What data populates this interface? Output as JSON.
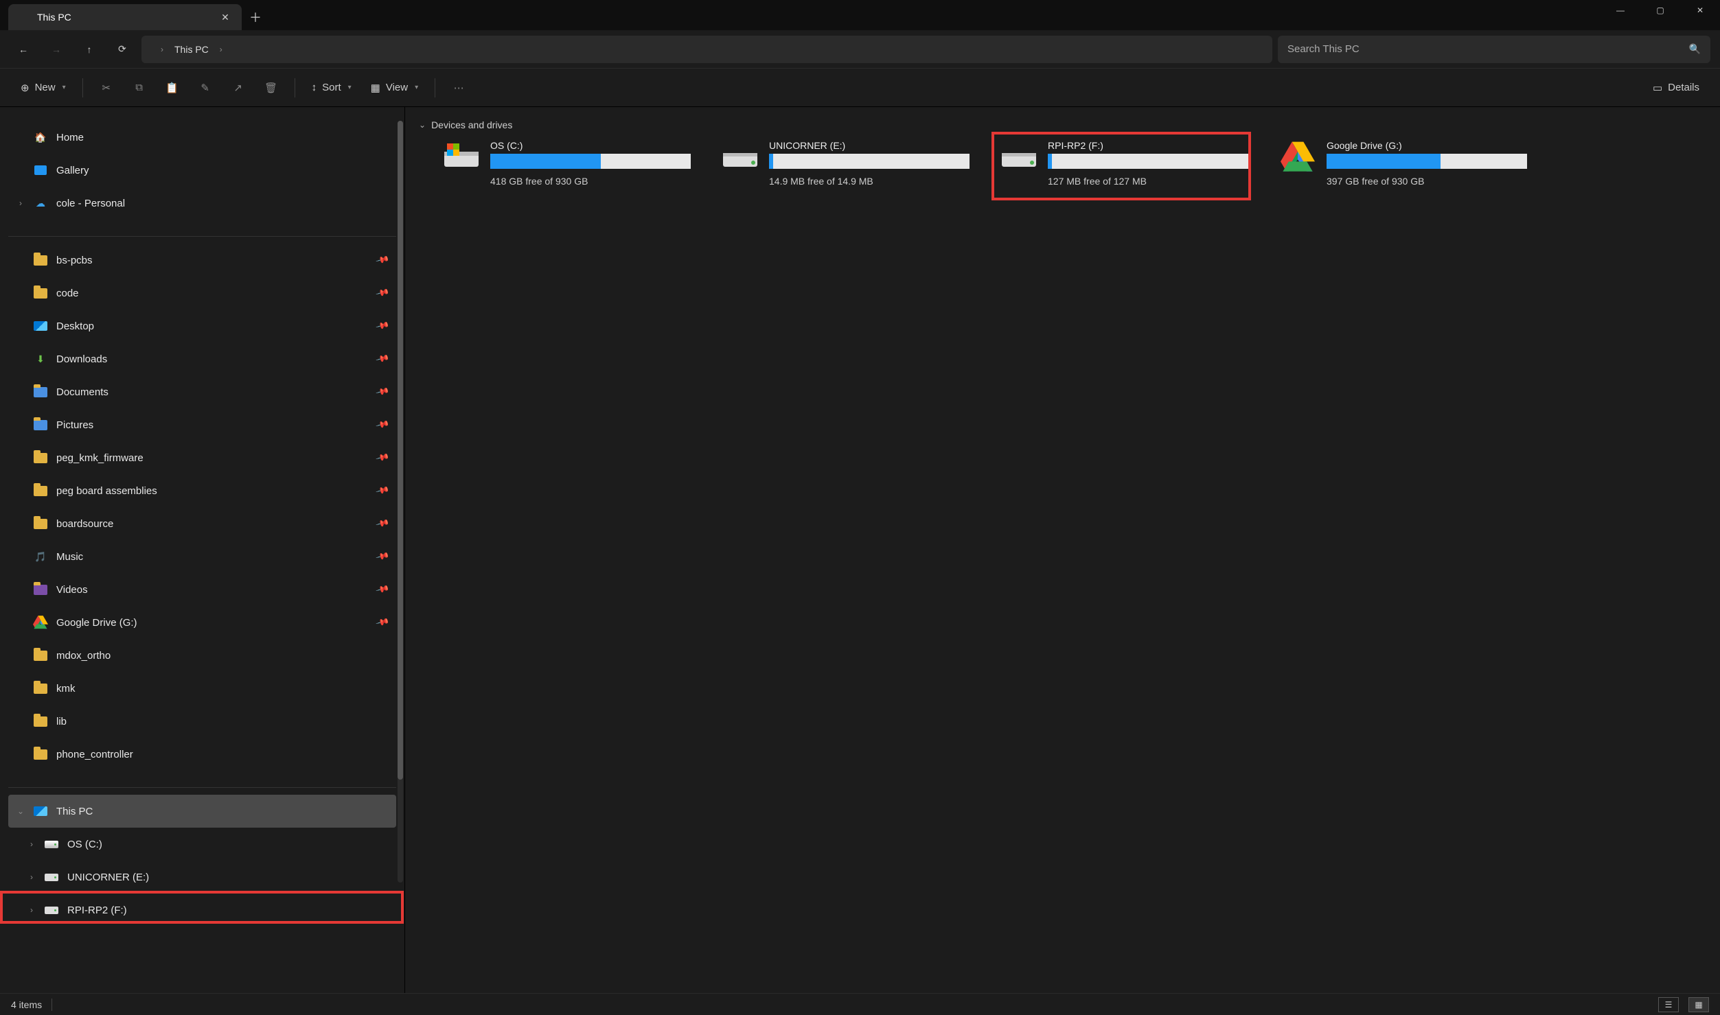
{
  "window": {
    "tab_title": "This PC",
    "min_icon": "—",
    "max_icon": "▢",
    "close_icon": "✕",
    "newtab_icon": "＋",
    "tab_close_icon": "✕"
  },
  "nav": {
    "back_icon": "←",
    "forward_icon": "→",
    "up_icon": "↑",
    "refresh_icon": "⟳",
    "pc_icon": "🖥",
    "crumb_sep": "›",
    "crumb_current": "This PC",
    "search_placeholder": "Search This PC",
    "search_icon": "🔍"
  },
  "toolbar": {
    "new_label": "New",
    "new_icon": "⊕",
    "cut_icon": "✂",
    "copy_icon": "⧉",
    "paste_icon": "📋",
    "rename_icon": "✎",
    "share_icon": "↗",
    "delete_icon": "🗑",
    "sort_label": "Sort",
    "sort_icon": "↕",
    "view_label": "View",
    "view_icon": "▦",
    "more_icon": "⋯",
    "details_label": "Details",
    "details_icon": "▭"
  },
  "sidebar": {
    "top": [
      {
        "label": "Home",
        "icon": "home"
      },
      {
        "label": "Gallery",
        "icon": "gallery"
      },
      {
        "label": "cole - Personal",
        "icon": "cloud",
        "expandable": true
      }
    ],
    "pinned": [
      {
        "label": "bs-pcbs",
        "icon": "folder"
      },
      {
        "label": "code",
        "icon": "folder"
      },
      {
        "label": "Desktop",
        "icon": "desktop"
      },
      {
        "label": "Downloads",
        "icon": "downloads"
      },
      {
        "label": "Documents",
        "icon": "documents"
      },
      {
        "label": "Pictures",
        "icon": "pictures"
      },
      {
        "label": "peg_kmk_firmware",
        "icon": "folder"
      },
      {
        "label": "peg board assemblies",
        "icon": "folder"
      },
      {
        "label": "boardsource",
        "icon": "folder"
      },
      {
        "label": "Music",
        "icon": "music"
      },
      {
        "label": "Videos",
        "icon": "videos"
      },
      {
        "label": "Google Drive (G:)",
        "icon": "gdrive"
      }
    ],
    "unpinned": [
      {
        "label": "mdox_ortho",
        "icon": "folder"
      },
      {
        "label": "kmk",
        "icon": "folder"
      },
      {
        "label": "lib",
        "icon": "folder"
      },
      {
        "label": "phone_controller",
        "icon": "folder"
      }
    ],
    "thispc": {
      "label": "This PC",
      "children": [
        {
          "label": "OS (C:)",
          "icon": "osdrive"
        },
        {
          "label": "UNICORNER (E:)",
          "icon": "drive"
        },
        {
          "label": "RPI-RP2 (F:)",
          "icon": "drive",
          "highlighted": true
        }
      ]
    }
  },
  "content": {
    "group_header": "Devices and drives",
    "drives": [
      {
        "name": "OS (C:)",
        "free_text": "418 GB free of 930 GB",
        "fill_pct": 55,
        "icon": "osdrive"
      },
      {
        "name": "UNICORNER (E:)",
        "free_text": "14.9 MB free of 14.9 MB",
        "fill_pct": 2,
        "icon": "drive"
      },
      {
        "name": "RPI-RP2 (F:)",
        "free_text": "127 MB free of 127 MB",
        "fill_pct": 2,
        "icon": "drive",
        "highlighted": true
      },
      {
        "name": "Google Drive (G:)",
        "free_text": "397 GB free of 930 GB",
        "fill_pct": 57,
        "icon": "gdrive"
      }
    ]
  },
  "status": {
    "item_count": "4 items"
  },
  "colors": {
    "accent": "#2196f3",
    "highlight_red": "#e53935"
  }
}
